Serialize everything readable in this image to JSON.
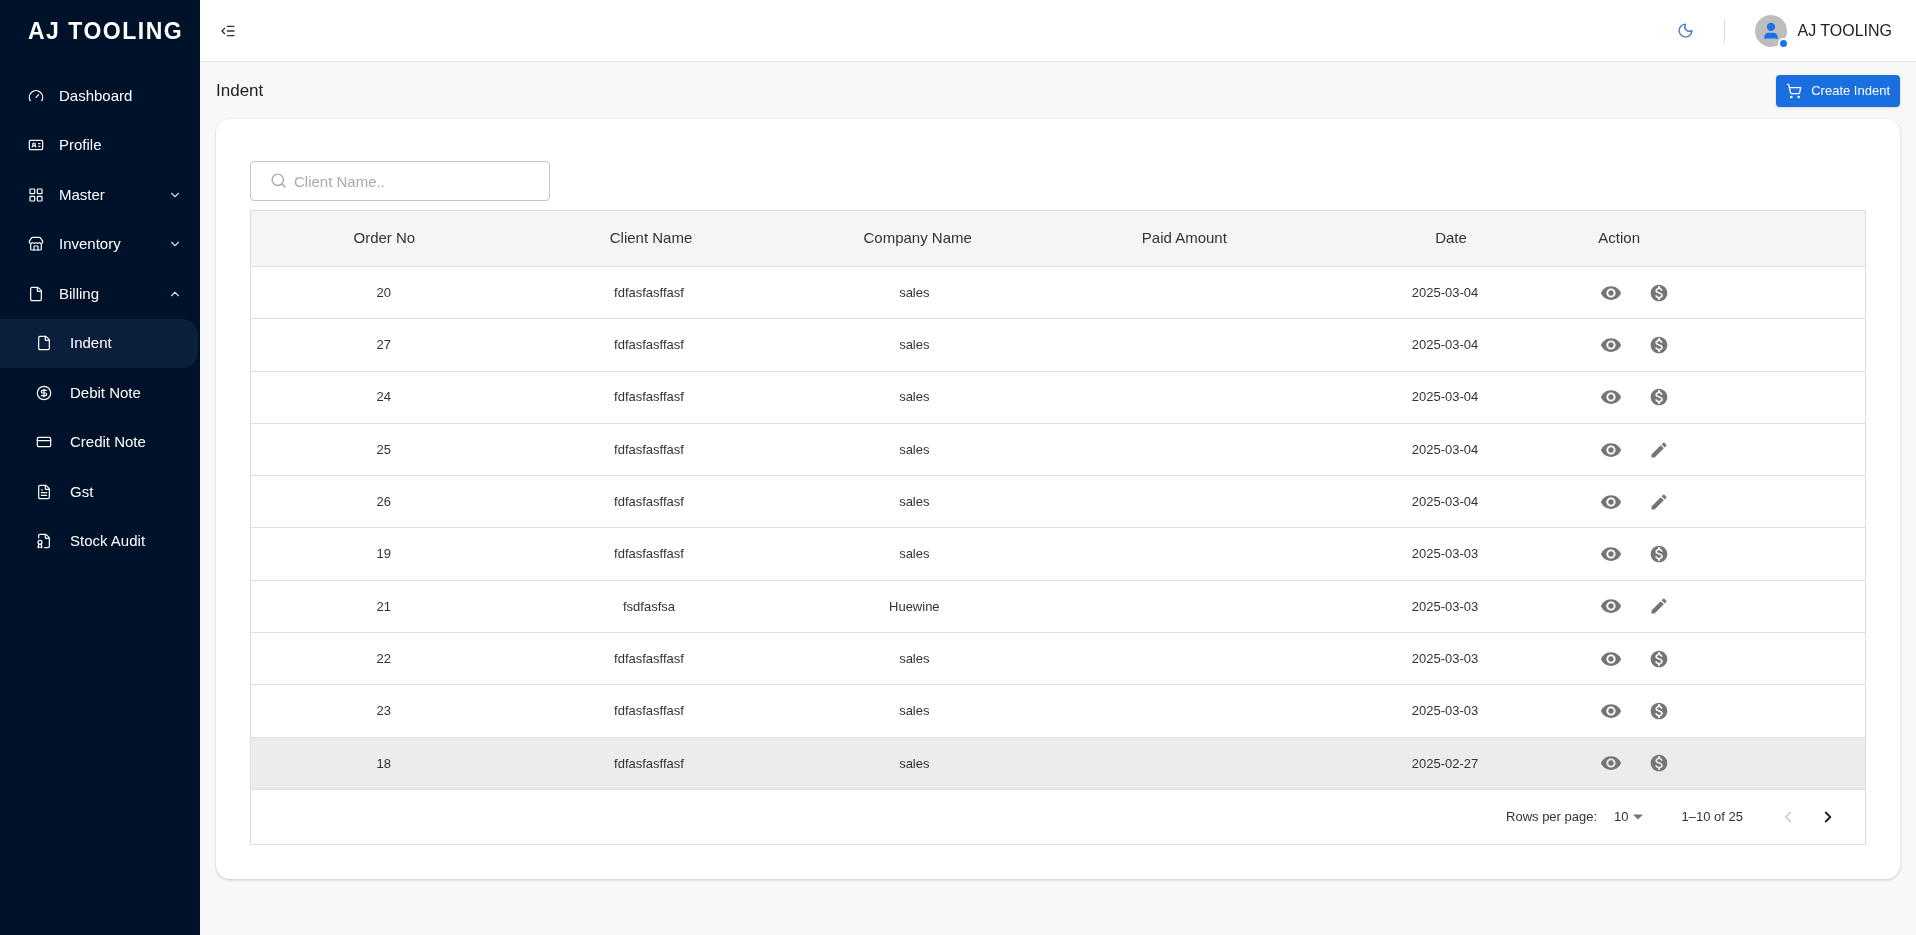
{
  "brand": "AJ TOOLING",
  "sidebar": {
    "items": [
      {
        "label": "Dashboard",
        "selected": false
      },
      {
        "label": "Profile",
        "selected": false
      },
      {
        "label": "Master",
        "selected": false,
        "expanded": false
      },
      {
        "label": "Inventory",
        "selected": false,
        "expanded": false
      },
      {
        "label": "Billing",
        "selected": false,
        "expanded": true,
        "children": [
          {
            "label": "Indent",
            "selected": true
          },
          {
            "label": "Debit Note",
            "selected": false
          },
          {
            "label": "Credit Note",
            "selected": false
          },
          {
            "label": "Gst",
            "selected": false
          },
          {
            "label": "Stock Audit",
            "selected": false
          }
        ]
      }
    ]
  },
  "header": {
    "user": "AJ TOOLING"
  },
  "page": {
    "title": "Indent",
    "create_button": "Create Indent"
  },
  "search": {
    "placeholder": "Client Name.."
  },
  "table": {
    "columns": [
      "Order No",
      "Client Name",
      "Company Name",
      "Paid Amount",
      "Date",
      "Action"
    ],
    "rows": [
      {
        "order_no": "20",
        "client": "fdfasfasffasf",
        "company": "sales",
        "date": "2025-03-04",
        "kind": "pay",
        "highlighted": false
      },
      {
        "order_no": "27",
        "client": "fdfasfasffasf",
        "company": "sales",
        "date": "2025-03-04",
        "kind": "pay",
        "highlighted": false
      },
      {
        "order_no": "24",
        "client": "fdfasfasffasf",
        "company": "sales",
        "date": "2025-03-04",
        "kind": "pay",
        "highlighted": false
      },
      {
        "order_no": "25",
        "client": "fdfasfasffasf",
        "company": "sales",
        "date": "2025-03-04",
        "kind": "edit",
        "highlighted": false
      },
      {
        "order_no": "26",
        "client": "fdfasfasffasf",
        "company": "sales",
        "date": "2025-03-04",
        "kind": "edit",
        "highlighted": false
      },
      {
        "order_no": "19",
        "client": "fdfasfasffasf",
        "company": "sales",
        "date": "2025-03-03",
        "kind": "pay",
        "highlighted": false
      },
      {
        "order_no": "21",
        "client": "fsdfasfsa",
        "company": "Huewine",
        "date": "2025-03-03",
        "kind": "edit",
        "highlighted": false
      },
      {
        "order_no": "22",
        "client": "fdfasfasffasf",
        "company": "sales",
        "date": "2025-03-03",
        "kind": "pay",
        "highlighted": false
      },
      {
        "order_no": "23",
        "client": "fdfasfasffasf",
        "company": "sales",
        "date": "2025-03-03",
        "kind": "pay",
        "highlighted": false
      },
      {
        "order_no": "18",
        "client": "fdfasfasffasf",
        "company": "sales",
        "date": "2025-02-27",
        "kind": "pay",
        "highlighted": true
      }
    ]
  },
  "pagination": {
    "rows_per_page_label": "Rows per page:",
    "rows_per_page": "10",
    "range": "1–10 of 25",
    "prev_disabled": true,
    "next_disabled": false
  }
}
